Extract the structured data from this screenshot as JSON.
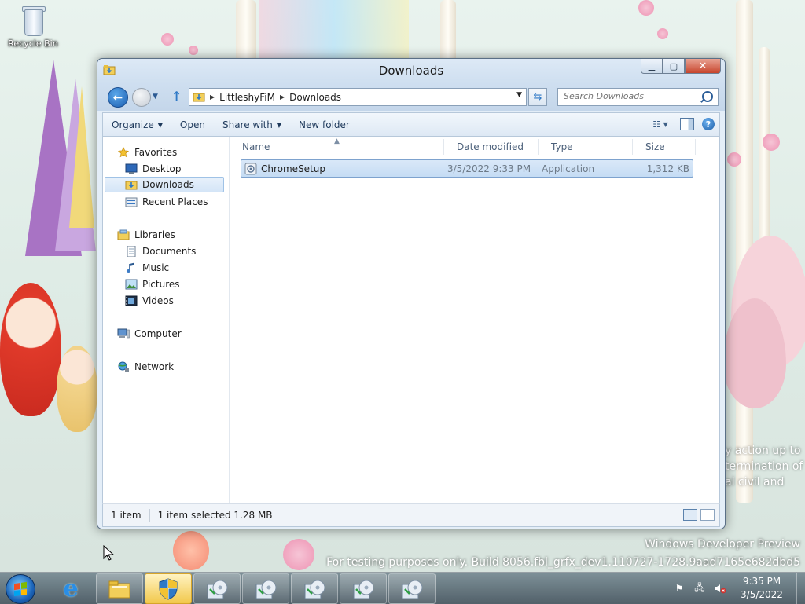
{
  "desktop": {
    "recycle_bin_label": "Recycle Bin",
    "watermark_line1": "Windows Developer Preview",
    "watermark_line2": "For testing purposes only. Build 8056.fbl_grfx_dev1.110727-1728.9aad7165e682dbd5",
    "legal_lines": [
      "y action up to",
      "termination of",
      "al civil and"
    ]
  },
  "window": {
    "title": "Downloads",
    "caption_buttons": {
      "minimize": "minimize-icon",
      "maximize": "maximize-icon",
      "close": "close-icon"
    },
    "address": {
      "crumbs": [
        "LittleshyFiM",
        "Downloads"
      ]
    },
    "search": {
      "placeholder": "Search Downloads"
    },
    "commands": {
      "organize": "Organize",
      "open": "Open",
      "share_with": "Share with",
      "new_folder": "New folder"
    },
    "nav_pane": {
      "favorites": "Favorites",
      "desktop": "Desktop",
      "downloads": "Downloads",
      "recent_places": "Recent Places",
      "libraries": "Libraries",
      "documents": "Documents",
      "music": "Music",
      "pictures": "Pictures",
      "videos": "Videos",
      "computer": "Computer",
      "network": "Network",
      "selected": "Downloads"
    },
    "columns": {
      "name": "Name",
      "date_modified": "Date modified",
      "type": "Type",
      "size": "Size"
    },
    "files": [
      {
        "name": "ChromeSetup",
        "date_modified": "3/5/2022 9:33 PM",
        "type": "Application",
        "size": "1,312 KB",
        "selected": true
      }
    ],
    "status": {
      "count": "1 item",
      "selection": "1 item selected",
      "selection_size": "1.28 MB"
    }
  },
  "taskbar": {
    "clock_time": "9:35 PM",
    "clock_date": "3/5/2022"
  },
  "colors": {
    "accent": "#2f79c6",
    "selection": "#c5dcf4",
    "close_button": "#c7452d"
  }
}
